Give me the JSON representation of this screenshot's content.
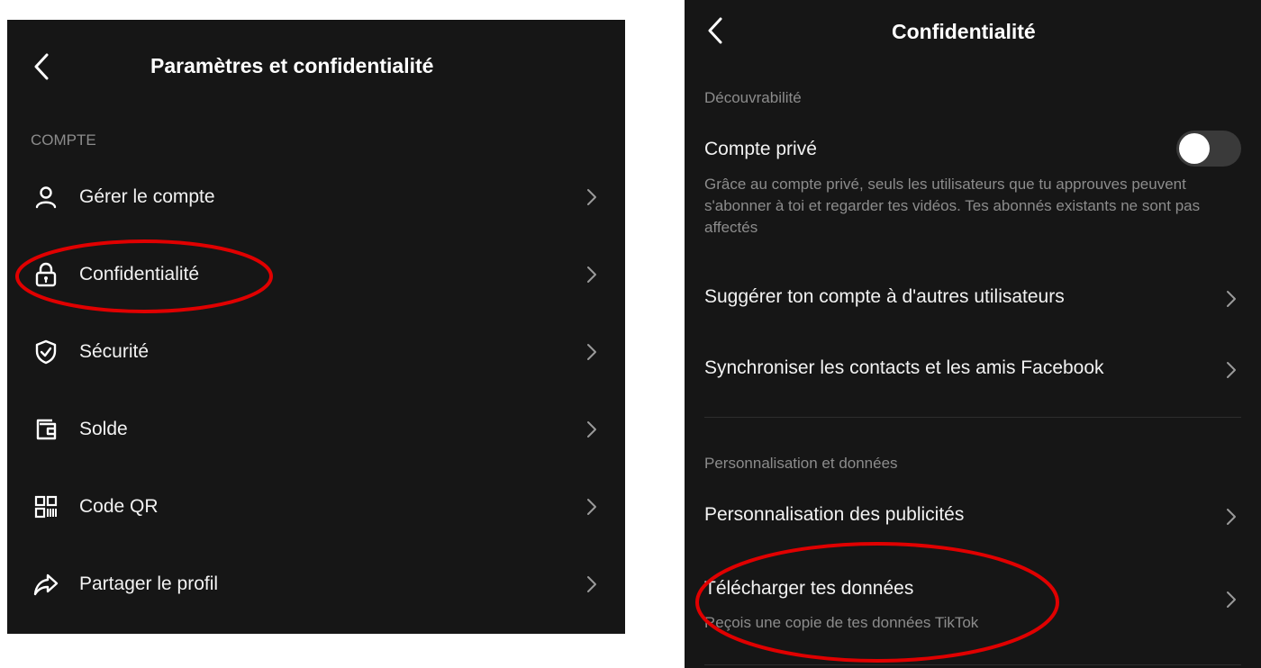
{
  "left": {
    "title": "Paramètres et confidentialité",
    "section": "COMPTE",
    "items": [
      {
        "label": "Gérer le compte",
        "icon": "person-icon"
      },
      {
        "label": "Confidentialité",
        "icon": "lock-icon"
      },
      {
        "label": "Sécurité",
        "icon": "shield-icon"
      },
      {
        "label": "Solde",
        "icon": "wallet-icon"
      },
      {
        "label": "Code QR",
        "icon": "qr-code-icon"
      },
      {
        "label": "Partager le profil",
        "icon": "share-icon"
      }
    ]
  },
  "right": {
    "title": "Confidentialité",
    "section_discoverability": "Découvrabilité",
    "private_account": {
      "label": "Compte privé",
      "enabled": false,
      "description": "Grâce au compte privé, seuls les utilisateurs que tu approuves peuvent s'abonner à toi et regarder tes vidéos. Tes abonnés existants ne sont pas affectés"
    },
    "suggest_label": "Suggérer ton compte à d'autres utilisateurs",
    "sync_label": "Synchroniser les contacts et les amis Facebook",
    "section_personalization": "Personnalisation et données",
    "ads_label": "Personnalisation des publicités",
    "download": {
      "label": "Télécharger tes données",
      "description": "Reçois une copie de tes données TikTok"
    }
  },
  "colors": {
    "panel_background": "#161616",
    "text_primary": "#f2f2f2",
    "text_secondary": "#8c8c8c",
    "annotation_red": "#e00000",
    "toggle_off": "#3a3a3a"
  }
}
